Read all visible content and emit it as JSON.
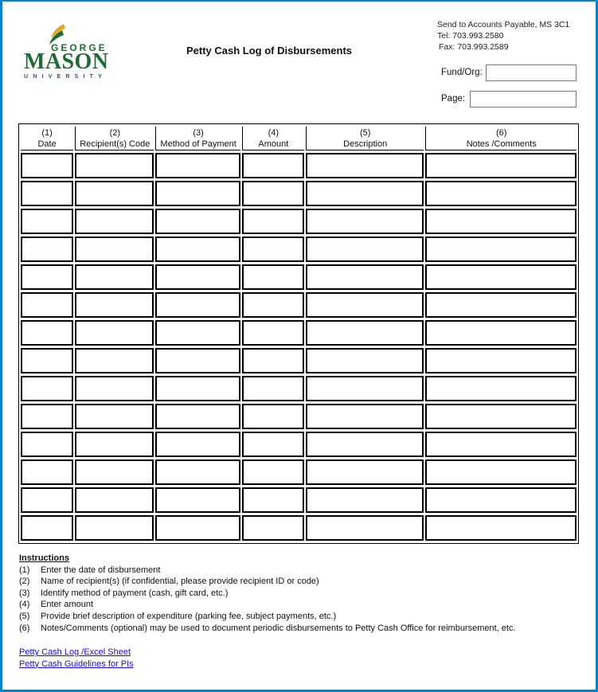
{
  "brand": {
    "name_top": "GEORGE",
    "name_main": "MASON",
    "name_sub": "UNIVERSITY",
    "green": "#1e6b35",
    "gold": "#e5a823"
  },
  "title": "Petty Cash Log of Disbursements",
  "contact": {
    "send_to": "Send to Accounts Payable, MS 3C1",
    "tel": "Tel:  703.993.2580",
    "fax": "Fax: 703.993.2589"
  },
  "fields": {
    "fund_org_label": "Fund/Org:",
    "fund_org_value": "",
    "page_label": "Page:",
    "page_value": ""
  },
  "table": {
    "columns": [
      {
        "num": "(1)",
        "label": "Date"
      },
      {
        "num": "(2)",
        "label": "Recipient(s) Code"
      },
      {
        "num": "(3)",
        "label": "Method of Payment"
      },
      {
        "num": "(4)",
        "label": "Amount"
      },
      {
        "num": "(5)",
        "label": "Description"
      },
      {
        "num": "(6)",
        "label": "Notes /Comments"
      }
    ],
    "row_count": 14
  },
  "instructions": {
    "heading": "Instructions",
    "items": [
      {
        "num": "(1)",
        "text": "Enter the date of disbursement"
      },
      {
        "num": "(2)",
        "text": "Name of recipient(s) (if confidential, please provide recipient ID or code)"
      },
      {
        "num": "(3)",
        "text": "Identify method of payment (cash, gift card, etc.)"
      },
      {
        "num": "(4)",
        "text": "Enter amount"
      },
      {
        "num": "(5)",
        "text": "Provide brief description of expenditure (parking fee, subject payments, etc.)"
      },
      {
        "num": "(6)",
        "text": "Notes/Comments (optional) may be used to document periodic disbursements to Petty Cash Office for reimbursement, etc."
      }
    ]
  },
  "links": [
    {
      "label": "Petty Cash Log /Excel Sheet"
    },
    {
      "label": "Petty Cash Guidelines for PIs"
    }
  ]
}
